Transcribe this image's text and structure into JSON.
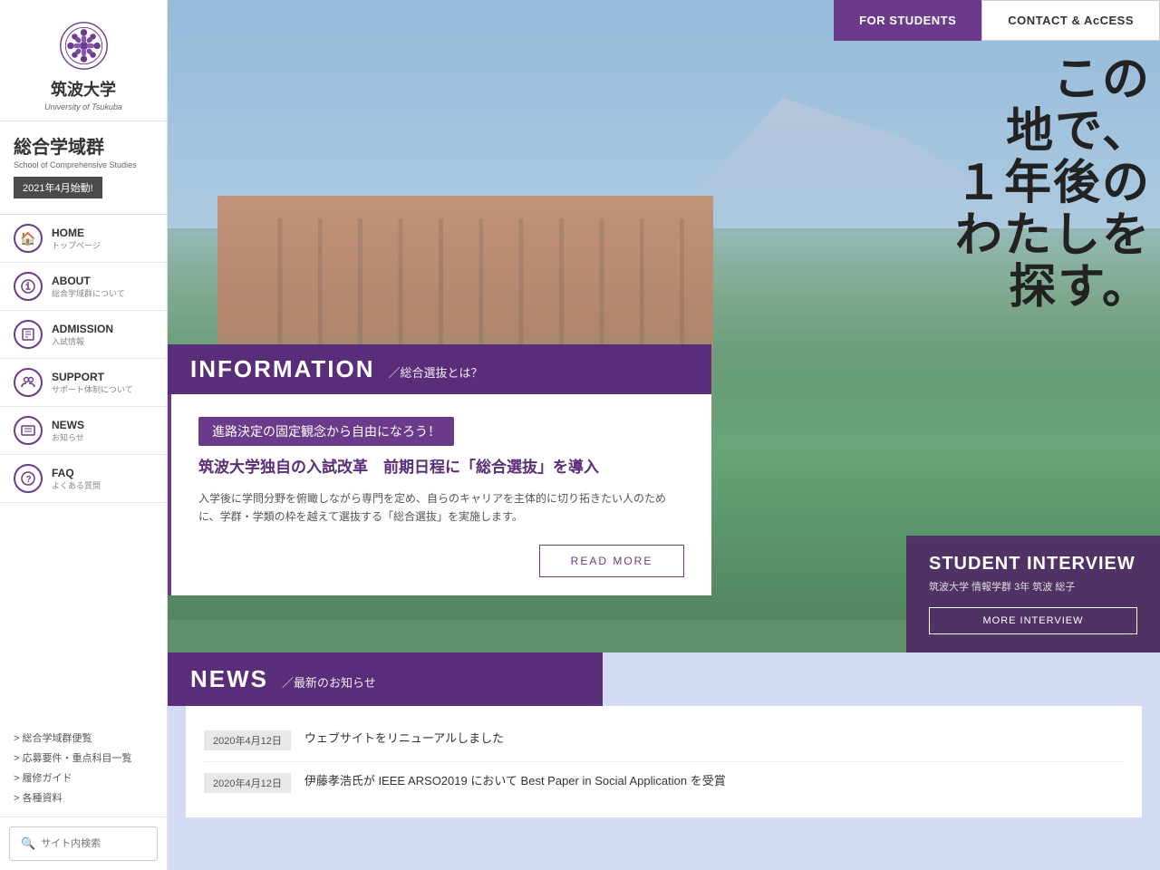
{
  "university": {
    "name_jp": "筑波大学",
    "name_en": "University of Tsukuba",
    "school_jp": "総合学域群",
    "school_en": "School of Comprehensive Studies",
    "badge": "2021年4月始動!"
  },
  "top_nav": {
    "for_students": "FOR STUDENTS",
    "contact_access": "CONTACT & AcCESS"
  },
  "nav_items": [
    {
      "en": "HOME",
      "jp": "トップページ",
      "icon": "🏠"
    },
    {
      "en": "ABOUT",
      "jp": "総合学域群について",
      "icon": "ℹ"
    },
    {
      "en": "ADMISSION",
      "jp": "入試情報",
      "icon": "📅"
    },
    {
      "en": "SUPPORT",
      "jp": "サポート体制について",
      "icon": "👥"
    },
    {
      "en": "NEWS",
      "jp": "お知らせ",
      "icon": "📰"
    },
    {
      "en": "FAQ",
      "jp": "よくある質問",
      "icon": "❓"
    }
  ],
  "sidebar_links": [
    "> 総合学域群便覧",
    "> 応募要件・重点科目一覧",
    "> 履修ガイド",
    "> 各種資料"
  ],
  "search": {
    "placeholder": "サイト内検索"
  },
  "hero": {
    "lines": [
      "この",
      "地で、",
      "１年後の",
      "わたしを",
      "探す。"
    ]
  },
  "information": {
    "title": "INFORMATION",
    "subtitle": "／総合選抜とは？",
    "tag": "進路決定の固定観念から自由になろう！",
    "card_title": "筑波大学独自の入試改革　前期日程に「総合選抜」を導入",
    "card_body": "入学後に学問分野を俯瞰しながら専門を定め、自らのキャリアを主体的に切り拓きたい人のために、学群・学類の枠を越えて選抜する「総合選抜」を実施します。",
    "read_more": "READ MORE"
  },
  "student_interview": {
    "title": "STUDENT INTERVIEW",
    "name": "筑波大学 情報学群 3年 筑波 総子",
    "more_label": "MORE INTERVIEW"
  },
  "news": {
    "title": "NEWS",
    "subtitle": "／最新のお知らせ",
    "items": [
      {
        "date": "2020年4月12日",
        "text": "ウェブサイトをリニューアルしました"
      },
      {
        "date": "2020年4月12日",
        "text": "伊藤孝浩氏が IEEE ARSO2019 において Best Paper in Social Application を受賞"
      }
    ]
  }
}
